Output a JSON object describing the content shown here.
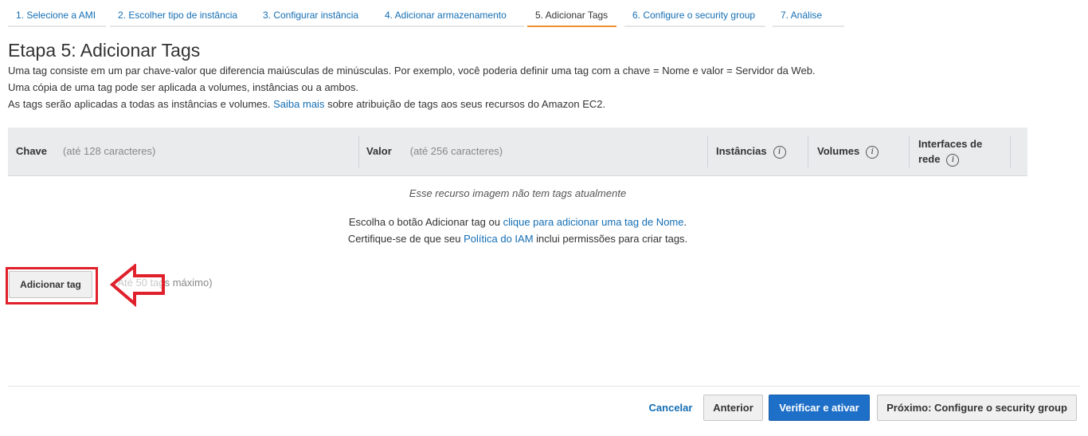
{
  "wizard": {
    "steps": [
      {
        "label": "1. Selecione a AMI"
      },
      {
        "label": "2. Escolher tipo de instância"
      },
      {
        "label": "3. Configurar instância"
      },
      {
        "label": "4. Adicionar armazenamento"
      },
      {
        "label": "5. Adicionar Tags"
      },
      {
        "label": "6. Configure o security group"
      },
      {
        "label": "7. Análise"
      }
    ],
    "active_step": 5
  },
  "page": {
    "title": "Etapa 5: Adicionar Tags",
    "intro_line1": "Uma tag consiste em um par chave-valor que diferencia maiúsculas de minúsculas. Por exemplo, você poderia definir uma tag com a chave = Nome e valor = Servidor da Web.",
    "intro_line2": "Uma cópia de uma tag pode ser aplicada a volumes, instâncias ou a ambos.",
    "intro_line3_prefix": "As tags serão aplicadas a todas as instâncias e volumes.",
    "intro_line3_link": "Saiba mais",
    "intro_line3_suffix": "sobre atribuição de tags aos seus recursos do Amazon EC2."
  },
  "table": {
    "key_header": "Chave",
    "key_hint": "(até 128 caracteres)",
    "value_header": "Valor",
    "value_hint": "(até 256 caracteres)",
    "instances_header": "Instâncias",
    "volumes_header": "Volumes",
    "interfaces_header_line1": "Interfaces de",
    "interfaces_header_line2": "rede",
    "info_glyph": "i",
    "empty_message": "Esse recurso imagem não tem tags atualmente",
    "help_line1_prefix": "Escolha o botão Adicionar tag ou",
    "help_line1_link": "clique para adicionar uma tag de Nome",
    "help_line1_suffix": ".",
    "help_line2_prefix": "Certifique-se de que seu",
    "help_line2_link": "Política do IAM",
    "help_line2_suffix": "inclui permissões para criar tags."
  },
  "add_tag": {
    "button_label": "Adicionar tag",
    "max_hint": "(Até 50 tags máximo)"
  },
  "annotation": {
    "highlight_color": "#e0202a",
    "arrow_icon": "left-arrow-outline-icon"
  },
  "footer": {
    "cancel_label": "Cancelar",
    "previous_label": "Anterior",
    "review_label": "Verificar e ativar",
    "next_label": "Próximo: Configure o security group"
  },
  "colors": {
    "link": "#146eb4",
    "primary_button": "#1e6fc8",
    "active_step_underline": "#ec912d",
    "table_header_bg": "#e9ebed"
  }
}
